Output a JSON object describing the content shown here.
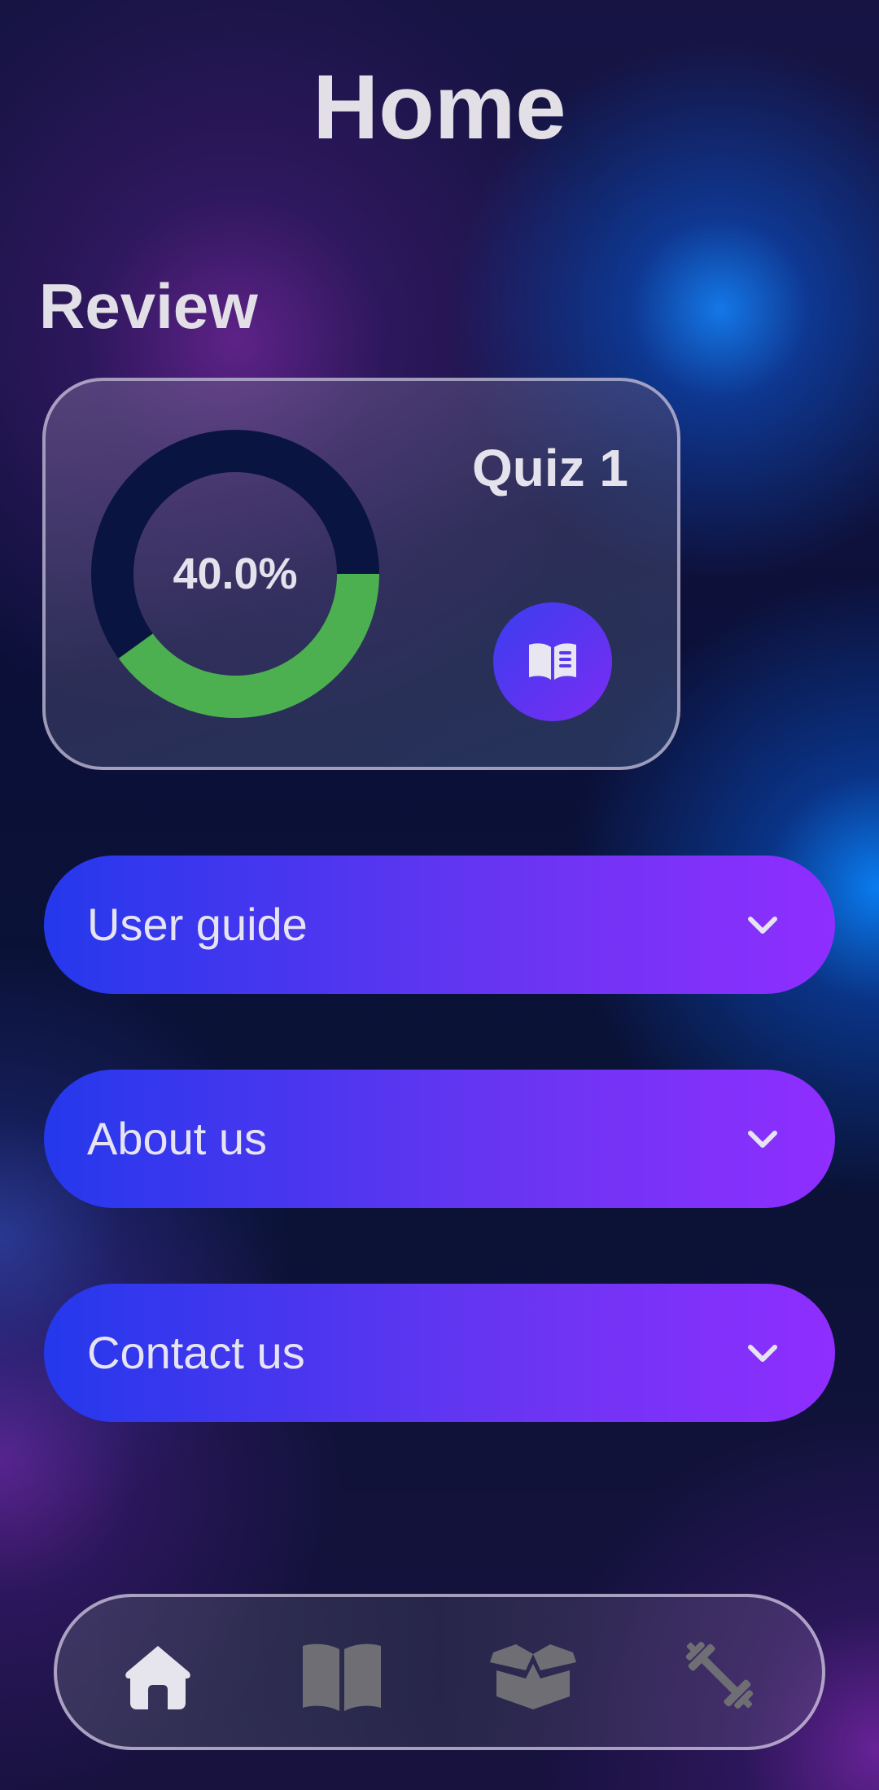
{
  "header": {
    "title": "Home"
  },
  "review": {
    "section_title": "Review",
    "card": {
      "quiz_title": "Quiz 1",
      "percent_label": "40.0%",
      "progress": 0.4,
      "progress_color": "#4caf50",
      "track_color": "#0a1440",
      "action_icon": "book-reader-icon"
    }
  },
  "accordions": [
    {
      "label": "User guide",
      "icon": "chevron-down-icon"
    },
    {
      "label": "About us",
      "icon": "chevron-down-icon"
    },
    {
      "label": "Contact us",
      "icon": "chevron-down-icon"
    }
  ],
  "bottom_nav": {
    "items": [
      {
        "icon": "home-icon",
        "active": true
      },
      {
        "icon": "book-icon",
        "active": false
      },
      {
        "icon": "open-box-icon",
        "active": false
      },
      {
        "icon": "dumbbell-icon",
        "active": false
      }
    ],
    "active_color": "#e6e4ec",
    "inactive_color": "#6e6e74"
  },
  "colors": {
    "accent_start": "#2538ec",
    "accent_end": "#8f2eff"
  }
}
